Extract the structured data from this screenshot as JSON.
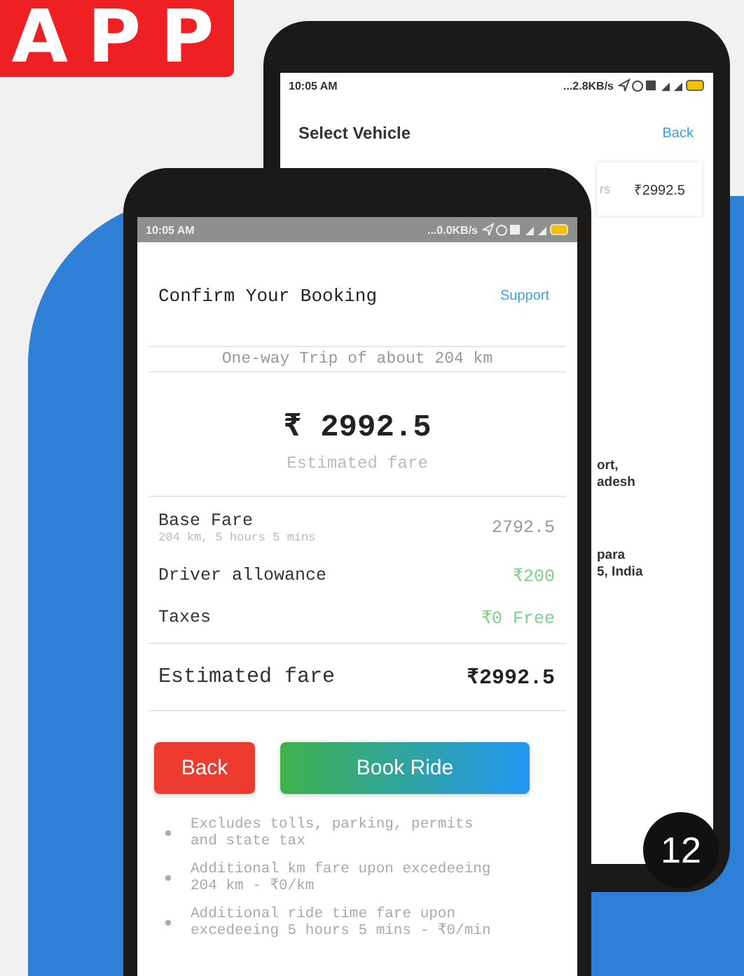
{
  "banner": {
    "text": "APP"
  },
  "back_phone": {
    "status_bar": {
      "time": "10:05 AM",
      "speed": "...2.8KB/s"
    },
    "title": "Select Vehicle",
    "back_link": "Back",
    "vehicle_card": {
      "column_1": "rs",
      "price": "₹2992.5"
    },
    "address_fragments": [
      {
        "line_1": "ort,",
        "line_2": "adesh"
      },
      {
        "line_1": "para",
        "line_2": "5, India"
      }
    ]
  },
  "front_phone": {
    "status_bar": {
      "time": "10:05 AM",
      "speed": "...0.0KB/s"
    },
    "title": "Confirm Your Booking",
    "support_link": "Support",
    "trip": "One-way Trip of about 204 km",
    "amount": "₹ 2992.5",
    "amount_label": "Estimated fare",
    "fare_rows": [
      {
        "label": "Base Fare",
        "sublabel": "204 km, 5 hours 5 mins",
        "value": "2792.5",
        "kind": "plain"
      },
      {
        "label": "Driver allowance",
        "value": "₹200",
        "kind": "credit"
      },
      {
        "label": "Taxes",
        "value": "₹0 Free",
        "kind": "credit"
      }
    ],
    "total": {
      "label": "Estimated fare",
      "value": "₹2992.5"
    },
    "buttons": [
      {
        "label": "Back",
        "kind": "danger"
      },
      {
        "label": "Book Ride",
        "kind": "primary"
      }
    ],
    "notes": [
      "Excludes tolls, parking, permits and state tax",
      "Additional km fare upon excedeeing 204 km - ₹0/km",
      "Additional ride time fare upon excedeeing 5 hours 5 mins - ₹0/min"
    ]
  },
  "badge": {
    "text": "12"
  }
}
